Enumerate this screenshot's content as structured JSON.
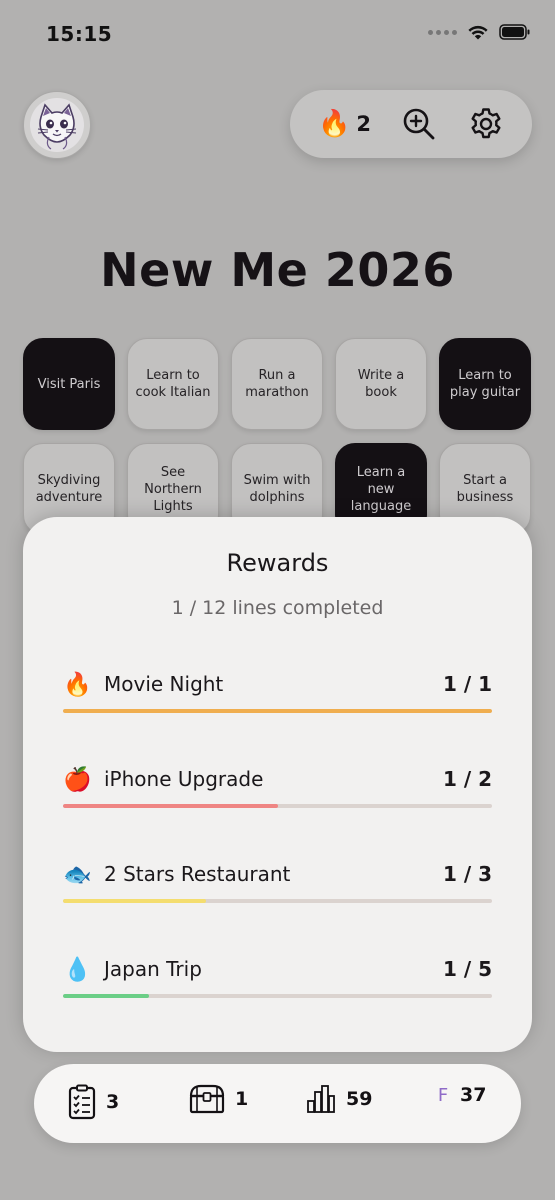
{
  "status_bar": {
    "time": "15:15"
  },
  "header": {
    "streak_emoji": "🔥",
    "streak_count": "2"
  },
  "title": "New Me 2026",
  "tiles": [
    {
      "label": "Visit Paris",
      "done": true
    },
    {
      "label": "Learn to cook Italian",
      "done": false
    },
    {
      "label": "Run a marathon",
      "done": false
    },
    {
      "label": "Write a book",
      "done": false
    },
    {
      "label": "Learn to play guitar",
      "done": true
    },
    {
      "label": "Skydiving adventure",
      "done": false
    },
    {
      "label": "See Northern Lights",
      "done": false
    },
    {
      "label": "Swim with dolphins",
      "done": false
    },
    {
      "label": "Learn a new language",
      "done": true
    },
    {
      "label": "Start a business",
      "done": false
    }
  ],
  "rewards": {
    "title": "Rewards",
    "subtitle": "1 / 12 lines completed",
    "items": [
      {
        "emoji": "🔥",
        "name": "Movie Night",
        "count": "1 / 1",
        "progress": 1.0,
        "color": "#f0ae4f"
      },
      {
        "emoji": "🍎",
        "name": "iPhone Upgrade",
        "count": "1 / 2",
        "progress": 0.5,
        "color": "#ef8583"
      },
      {
        "emoji": "🐟",
        "name": "2 Stars Restaurant",
        "count": "1 / 3",
        "progress": 0.333,
        "color": "#f4dd6f"
      },
      {
        "emoji": "💧",
        "name": "Japan Trip",
        "count": "1 / 5",
        "progress": 0.2,
        "color": "#6bce86"
      }
    ]
  },
  "bottom_bar": {
    "tasks": {
      "icon": "clipboard-checklist-icon",
      "value": "3"
    },
    "chests": {
      "icon": "treasure-chest-icon",
      "value": "1"
    },
    "stats": {
      "icon": "bar-chart-icon",
      "value": "59"
    },
    "grade": {
      "letter": "F",
      "value": "37",
      "letter_color": "#8f6bc7"
    }
  }
}
